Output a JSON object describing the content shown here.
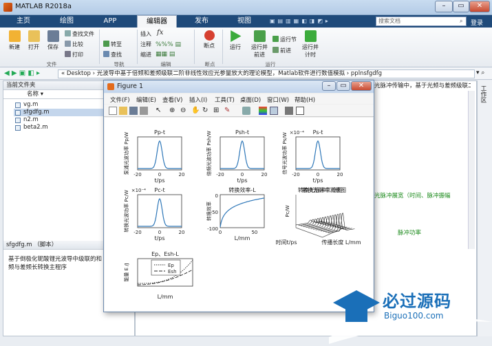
{
  "window": {
    "title": "MATLAB R2018a",
    "min": "–",
    "max": "▭",
    "close": "✕"
  },
  "tabs": [
    "主页",
    "绘图",
    "APP",
    "编辑器",
    "发布",
    "视图"
  ],
  "search_placeholder": "搜索文档",
  "login": "登录",
  "ribbon": {
    "new": "新建",
    "open": "打开",
    "save": "保存",
    "find_files": "查找文件",
    "compare": "比较",
    "print": "打印",
    "goto": "转至",
    "find": "查找",
    "insert": "插入",
    "comment": "注释",
    "indent": "缩进",
    "breakpoint": "断点",
    "run": "运行",
    "run_advance": "运行并\n前进",
    "run_section": "运行节",
    "advance": "前进",
    "run_time": "运行并\n计时",
    "groups": [
      "文件",
      "导航",
      "编辑",
      "断点",
      "运行"
    ]
  },
  "address": "« Desktop › 光波导中基于倍频和差频级联二阶非线性效应光参量放大的理论模型，Matlab软件进行数值模拟 › pplnsfgdfg",
  "left_panel": {
    "title": "当前文件夹",
    "col": "名称 ▾",
    "files": [
      "vg.m",
      "sfgdfg.m",
      "n2.m",
      "beta2.m"
    ],
    "detail_title": "sfgdfg.m （脚本）",
    "detail_text": "基于倒极化铌酸锂光波导中级联的和频与差频长转换主程序"
  },
  "right_panel": {
    "tab_text": "光脉冲传输中，基于光频与差频级联二阶非线性效应光参量放大模型，级联二阶效应...",
    "text1": "光脉冲展宽（时间、脉冲振幅",
    "text2": "脉冲功率",
    "side": "工作区"
  },
  "figure": {
    "title": "Figure 1",
    "menu": [
      "文件(F)",
      "编辑(E)",
      "查看(V)",
      "插入(I)",
      "工具(T)",
      "桌面(D)",
      "窗口(W)",
      "帮助(H)"
    ]
  },
  "chart_data": [
    {
      "type": "line",
      "title": "Pp-t",
      "xlabel": "t/ps",
      "ylabel": "泵浦光波功率 Pp/W",
      "x_ticks": [
        "-20",
        "0",
        "20"
      ]
    },
    {
      "type": "line",
      "title": "Psh-t",
      "xlabel": "t/ps",
      "ylabel": "倍频光波功率 Psh/W",
      "x_ticks": [
        "-20",
        "0",
        "20"
      ]
    },
    {
      "type": "line",
      "title": "Ps-t",
      "xlabel": "t/ps",
      "ylabel": "信号光波功率 Ps/W",
      "y_exp": "×10⁻⁴",
      "x_ticks": [
        "-20",
        "0",
        "20"
      ]
    },
    {
      "type": "line",
      "title": "Pc-t",
      "xlabel": "t/ps",
      "ylabel": "转换光波功率 Pc/W",
      "y_exp": "×10⁻⁴",
      "x_ticks": [
        "-20",
        "0",
        "20"
      ]
    },
    {
      "type": "line",
      "title": "转换效率-L",
      "xlabel": "L/mm",
      "ylabel": "转换效率",
      "x_ticks": [
        "0",
        "50"
      ],
      "y_ticks": [
        "0",
        "-50",
        "-100"
      ]
    },
    {
      "type": "surface",
      "title": "转换光脉冲三维图",
      "xlabel": "传播长度 L/mm",
      "ylabel": "时间t/ps",
      "zlabel": "Pc/W"
    },
    {
      "type": "line",
      "title": "Ep、Esh-L",
      "xlabel": "L/mm",
      "ylabel": "能量 E /J",
      "legend": [
        "Ep",
        "Esh"
      ]
    }
  ],
  "watermark": {
    "cn": "必过源码",
    "url": "Biguo100.com"
  }
}
